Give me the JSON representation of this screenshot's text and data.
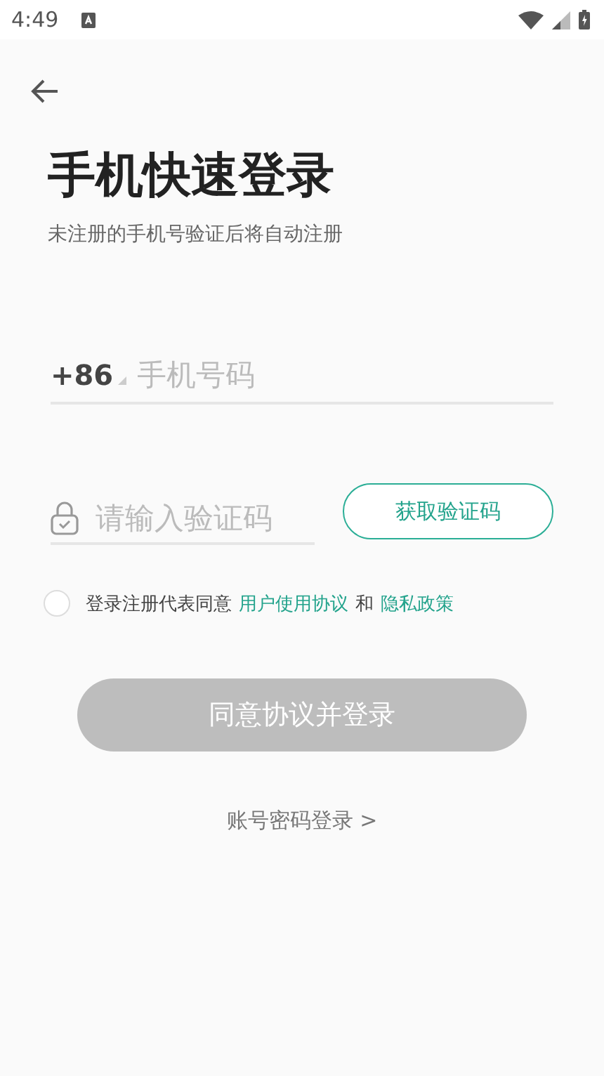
{
  "status_bar": {
    "time": "4:49"
  },
  "title": "手机快速登录",
  "subtitle": "未注册的手机号验证后将自动注册",
  "phone_field": {
    "country_code": "+86",
    "placeholder": "手机号码"
  },
  "code_field": {
    "placeholder": "请输入验证码"
  },
  "get_code_button": "获取验证码",
  "agreement": {
    "checked": false,
    "text": "登录注册代表同意",
    "link_1": "用户使用协议",
    "joiner": "和",
    "link_2": "隐私政策"
  },
  "login_button": {
    "label": "同意协议并登录",
    "disabled": true
  },
  "alt_login_link": "账号密码登录 >"
}
